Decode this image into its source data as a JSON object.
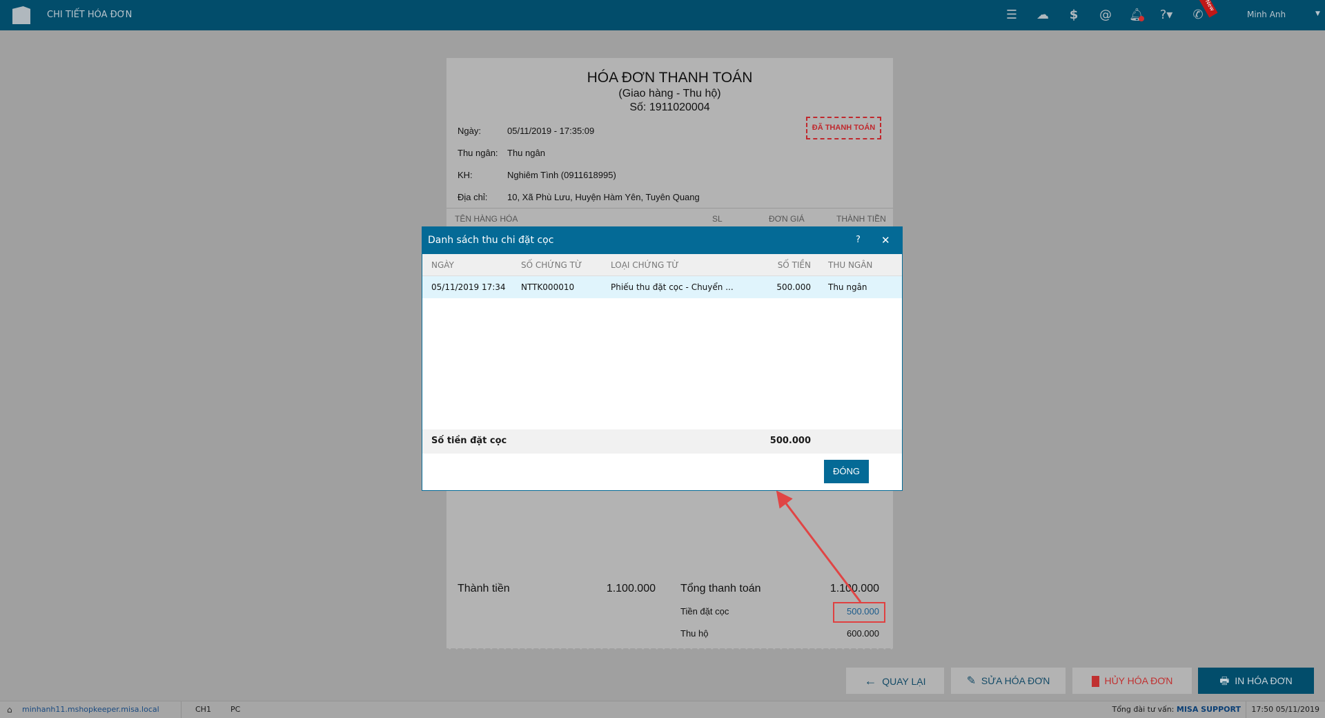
{
  "header": {
    "title": "CHI TIẾT HÓA ĐƠN",
    "user": "Minh Anh",
    "new_badge": "New"
  },
  "receipt": {
    "title": "HÓA ĐƠN THANH TOÁN",
    "subtitle": "(Giao hàng - Thu hộ)",
    "number": "Số: 1911020004",
    "stamp": "ĐÃ THANH TOÁN",
    "fields": [
      {
        "label": "Ngày:",
        "value": "05/11/2019 - 17:35:09"
      },
      {
        "label": "Thu ngân:",
        "value": "Thu ngân"
      },
      {
        "label": "KH:",
        "value": "Nghiêm Tình (0911618995)"
      },
      {
        "label": "Địa chỉ:",
        "value": "10, Xã Phù Lưu, Huyện Hàm Yên, Tuyên Quang"
      }
    ],
    "columns": [
      "TÊN HÀNG HÓA",
      "SL",
      "ĐƠN GIÁ",
      "THÀNH TIỀN"
    ],
    "subtotal_label": "Thành tiền",
    "subtotal": "1.100.000",
    "total_label": "Tổng thanh toán",
    "total": "1.100.000",
    "deposit_label": "Tiền đặt cọc",
    "deposit": "500.000",
    "cod_label": "Thu hộ",
    "cod": "600.000"
  },
  "dialog": {
    "title": "Danh sách thu chi đặt cọc",
    "help": "?",
    "close": "✕",
    "columns": [
      "NGÀY",
      "SỐ CHỨNG TỪ",
      "LOẠI CHỨNG TỪ",
      "SỐ TIỀN",
      "THU NGÂN"
    ],
    "rows": [
      {
        "date": "05/11/2019 17:34",
        "number": "NTTK000010",
        "type": "Phiếu thu đặt cọc - Chuyển ...",
        "amount": "500.000",
        "cashier": "Thu ngân"
      }
    ],
    "total_label": "Số tiền đặt cọc",
    "total": "500.000",
    "close_button": "ĐÓNG"
  },
  "actions": {
    "back": "QUAY LẠI",
    "edit": "SỬA HÓA ĐƠN",
    "cancel": "HỦY HÓA ĐƠN",
    "print": "IN HÓA ĐƠN"
  },
  "status": {
    "host": "minhanh11.mshopkeeper.misa.local",
    "branch": "CH1",
    "device": "PC",
    "support_label": "Tổng đài tư vấn:",
    "support": "MISA SUPPORT",
    "time": "17:50 05/11/2019"
  }
}
